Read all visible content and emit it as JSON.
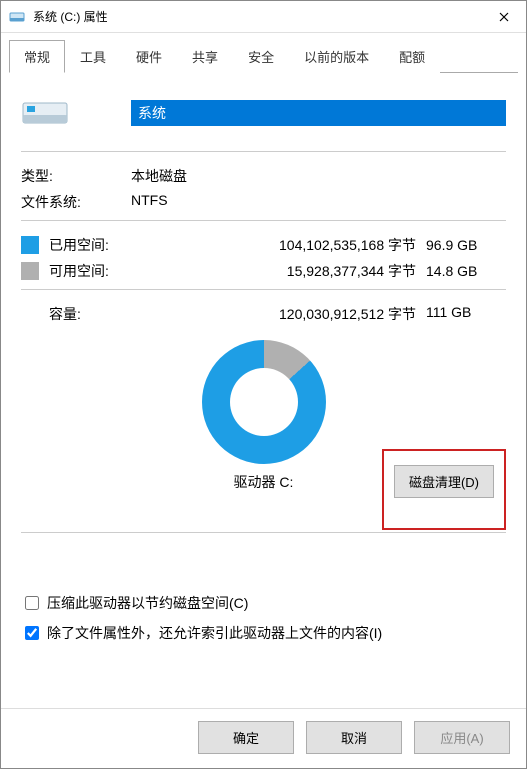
{
  "title": "系统 (C:) 属性",
  "tabs": {
    "general": "常规",
    "tools": "工具",
    "hardware": "硬件",
    "sharing": "共享",
    "security": "安全",
    "prev": "以前的版本",
    "quota": "配额"
  },
  "drive_name": "系统",
  "labels": {
    "type": "类型:",
    "fs": "文件系统:",
    "used": "已用空间:",
    "free": "可用空间:",
    "capacity": "容量:",
    "drive_caption": "驱动器 C:"
  },
  "values": {
    "type": "本地磁盘",
    "fs": "NTFS",
    "used_bytes": "104,102,535,168 字节",
    "used_gb": "96.9 GB",
    "free_bytes": "15,928,377,344 字节",
    "free_gb": "14.8 GB",
    "cap_bytes": "120,030,912,512 字节",
    "cap_gb": "111 GB"
  },
  "buttons": {
    "cleanup": "磁盘清理(D)",
    "ok": "确定",
    "cancel": "取消",
    "apply": "应用(A)"
  },
  "checks": {
    "compress": "压缩此驱动器以节约磁盘空间(C)",
    "index": "除了文件属性外，还允许索引此驱动器上文件的内容(I)"
  },
  "chart_data": {
    "type": "pie",
    "title": "驱动器 C:",
    "series": [
      {
        "name": "已用空间",
        "value": 96.9,
        "color": "#1e9ee5"
      },
      {
        "name": "可用空间",
        "value": 14.8,
        "color": "#b0b0b0"
      }
    ],
    "unit": "GB",
    "total": 111
  }
}
